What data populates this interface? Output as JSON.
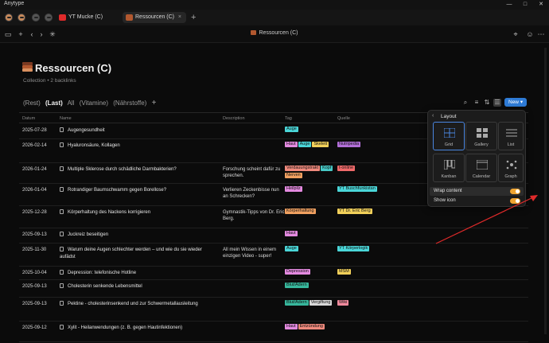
{
  "window": {
    "title": "Anytype"
  },
  "tabs": [
    {
      "label": "YT Mucke (C)",
      "icon_color": "#e02a2a"
    },
    {
      "label": "Ressourcen (C)",
      "icon_color": "#b2582f"
    }
  ],
  "toolbar": {
    "breadcrumb": "Ressourcen (C)"
  },
  "header": {
    "title": "Ressourcen (C)",
    "subtitle": "Collection  •  2 backlinks"
  },
  "views": {
    "items": [
      "(Rest)",
      "(Last)",
      "All",
      "(Vitamine)",
      "(Nährstoffe)"
    ],
    "active": "(Last)",
    "new_button": "New"
  },
  "table": {
    "columns": [
      "Datum",
      "Name",
      "Description",
      "Tag",
      "Quelle"
    ],
    "rows": [
      {
        "date": "2025-07-28",
        "name": "Augengesundheit",
        "desc": "",
        "tags": [
          {
            "t": "Auge",
            "c": "#4ad6d8"
          }
        ],
        "quelle": []
      },
      {
        "date": "2026-02-14",
        "name": "Hyaluronsäure, Kollagen",
        "desc": "",
        "tags": [
          {
            "t": "Haut",
            "c": "#e48ae0"
          },
          {
            "t": "Auge",
            "c": "#4ad6d8"
          },
          {
            "t": "Skelett",
            "c": "#f2d05a"
          }
        ],
        "quelle": [
          {
            "t": "Nutripedia",
            "c": "#b26fd8"
          }
        ]
      },
      {
        "date": "2026-01-24",
        "name": "Multiple Sklerose durch schädliche Darmbakterien?",
        "desc": "Forschung scheint dafür zu sprechen.",
        "tags": [
          {
            "t": "Verdauungstrakt",
            "c": "#f08a7d"
          },
          {
            "t": "Kopf",
            "c": "#47c9c6"
          },
          {
            "t": "Nerven",
            "c": "#f0a060"
          }
        ],
        "quelle": [
          {
            "t": "t-online",
            "c": "#f06a6a"
          }
        ]
      },
      {
        "date": "2026-01-04",
        "name": "Rotrandiger Baumschwamm gegen Borellose?",
        "desc": "Verlieren Zeckenbisse nun an Schrecken?",
        "tags": [
          {
            "t": "Heilpilz",
            "c": "#e48ae0"
          }
        ],
        "quelle": [
          {
            "t": "YT Buschfunkistan",
            "c": "#4ad6d8"
          }
        ]
      },
      {
        "date": "2025-12-28",
        "name": "Körperhaltung des Nackens korrigieren",
        "desc": "Gymnastik-Tipps von Dr. Eric Berg.",
        "tags": [
          {
            "t": "Körperhaltung",
            "c": "#f0a060"
          }
        ],
        "quelle": [
          {
            "t": "YT Dr. Eric Berg",
            "c": "#f2d05a"
          }
        ]
      },
      {
        "date": "2025-09-13",
        "name": "Juckreiz beseitigen",
        "desc": "",
        "tags": [
          {
            "t": "Haut",
            "c": "#e48ae0"
          }
        ],
        "quelle": []
      },
      {
        "date": "2025-11-30",
        "name": "Warum deine Augen schlechter werden – und wie du sie wieder aufädst",
        "desc": "All mein Wissen in einem einzigen Video - super!",
        "tags": [
          {
            "t": "Auge",
            "c": "#4ad6d8"
          }
        ],
        "quelle": [
          {
            "t": "YT Körperlogik",
            "c": "#4ad6d8"
          }
        ]
      },
      {
        "date": "2025-10-04",
        "name": "Depression: telefonische Hotline",
        "desc": "",
        "tags": [
          {
            "t": "Depression",
            "c": "#e48ae0"
          }
        ],
        "quelle": [
          {
            "t": "MSM",
            "c": "#f2d05a"
          }
        ]
      },
      {
        "date": "2025-09-13",
        "name": "Cholesterin senkende Lebensmittel",
        "desc": "",
        "tags": [
          {
            "t": "Blut/Adern",
            "c": "#37b79c"
          }
        ],
        "quelle": []
      },
      {
        "date": "2025-09-13",
        "name": "Pektine - cholesterinsenkend und zur Schwermetallausleitung",
        "desc": "",
        "tags": [
          {
            "t": "Blut/Adern",
            "c": "#37b79c"
          },
          {
            "t": "Vergiftung",
            "c": "#d8d8d8"
          }
        ],
        "quelle": [
          {
            "t": "Wiki",
            "c": "#f08a9d"
          }
        ]
      },
      {
        "date": "2025-09-12",
        "name": "Xylit - Heilanwendungen (z. B. gegen Hautinfektionen)",
        "desc": "",
        "tags": [
          {
            "t": "Haut",
            "c": "#e48ae0"
          },
          {
            "t": "Entzündung",
            "c": "#f08a7d"
          }
        ],
        "quelle": []
      }
    ]
  },
  "layout_popup": {
    "title": "Layout",
    "tiles": [
      "Grid",
      "Gallery",
      "List",
      "Kanban",
      "Calendar",
      "Graph"
    ],
    "selected": "Grid",
    "options": [
      {
        "label": "Wrap content",
        "on": true
      },
      {
        "label": "Show icon",
        "on": true
      }
    ]
  }
}
